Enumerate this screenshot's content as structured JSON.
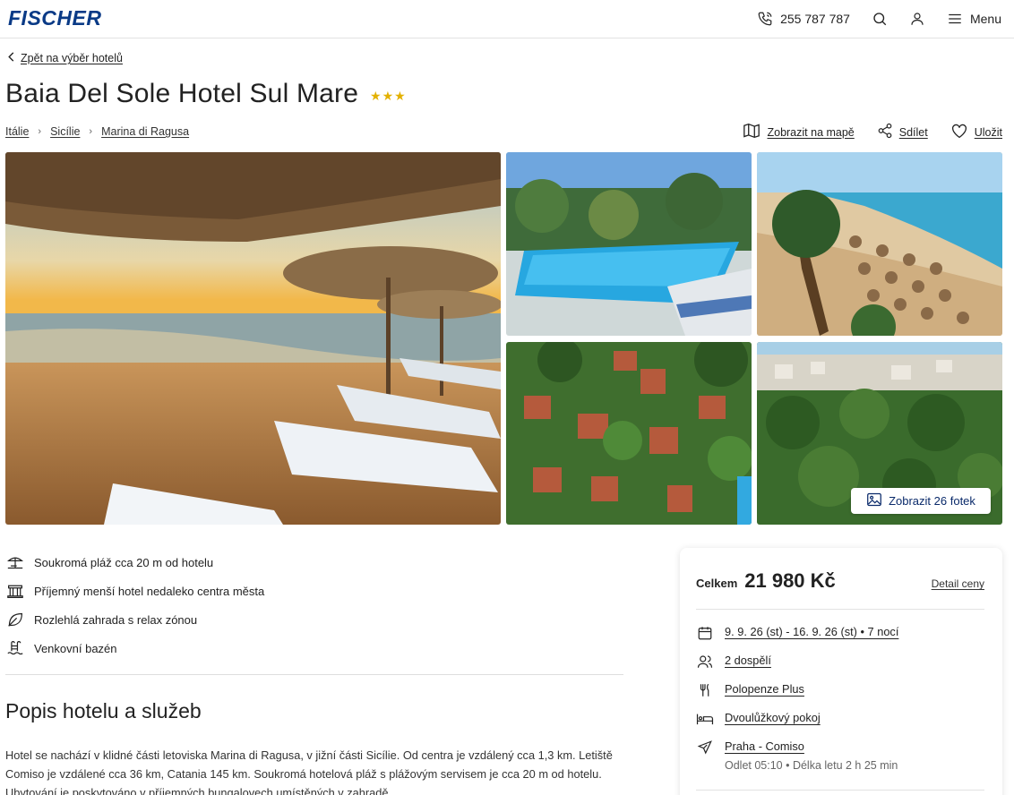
{
  "header": {
    "logo": "FISCHER",
    "phone": "255 787 787",
    "menu_label": "Menu",
    "brand_color": "#0a3a86"
  },
  "back_link": "Zpět na výběr hotelů",
  "hotel": {
    "name": "Baia Del Sole Hotel Sul Mare",
    "stars": 3
  },
  "breadcrumb": [
    "Itálie",
    "Sicílie",
    "Marina di Ragusa"
  ],
  "actions": {
    "map": "Zobrazit na mapě",
    "share": "Sdílet",
    "save": "Uložit"
  },
  "gallery": {
    "show_photos_label": "Zobrazit 26 fotek"
  },
  "features": [
    {
      "icon": "beach-umbrella-icon",
      "text": "Soukromá pláž cca 20 m od hotelu"
    },
    {
      "icon": "building-icon",
      "text": "Příjemný menší hotel nedaleko centra města"
    },
    {
      "icon": "leaf-icon",
      "text": "Rozlehlá zahrada s relax zónou"
    },
    {
      "icon": "pool-icon",
      "text": "Venkovní bazén"
    }
  ],
  "description": {
    "heading": "Popis hotelu a služeb",
    "text": "Hotel se nachází v klidné části letoviska Marina di Ragusa, v jižní části Sicílie. Od centra je vzdálený cca 1,3 km. Letiště Comiso je vzdálené cca 36 km, Catania 145 km. Soukromá hotelová pláž s plážovým servisem je cca 20 m od hotelu. Ubytování je poskytováno v příjemných bungalovech umístěných v zahradě."
  },
  "price_card": {
    "total_label": "Celkem",
    "total_value": "21 980 Kč",
    "detail_label": "Detail ceny",
    "dates": "9. 9. 26 (st) - 16. 9. 26 (st) • 7 nocí",
    "travelers": "2 dospělí",
    "board": "Polopenze Plus",
    "room": "Dvoulůžkový pokoj",
    "flight": "Praha - Comiso",
    "flight_info": "Odlet 05:10 • Délka letu 2 h 25 min"
  }
}
